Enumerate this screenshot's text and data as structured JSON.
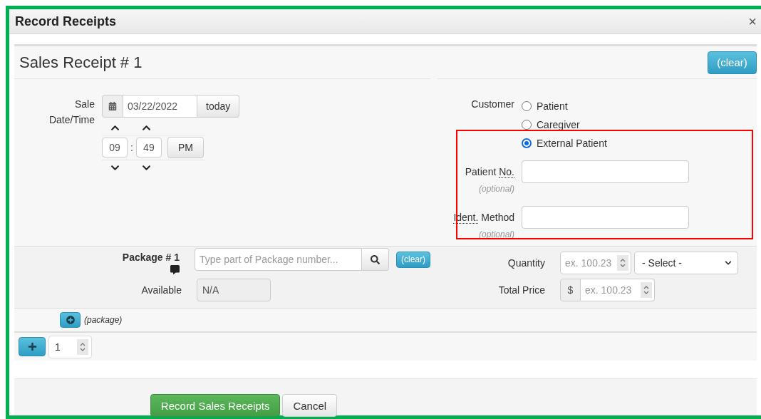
{
  "window": {
    "title": "Record Receipts",
    "close": "×"
  },
  "receipt": {
    "title": "Sales Receipt # 1",
    "clear_button": "(clear)"
  },
  "sale_datetime": {
    "label": "Sale Date/Time",
    "date": "03/22/2022",
    "today_button": "today",
    "hour": "09",
    "separator": ":",
    "minute": "49",
    "period": "PM"
  },
  "customer": {
    "label": "Customer",
    "options": [
      {
        "label": "Patient",
        "selected": false
      },
      {
        "label": "Caregiver",
        "selected": false
      },
      {
        "label": "External Patient",
        "selected": true
      }
    ]
  },
  "fields": [
    {
      "label_parts": [
        {
          "text": "Patient",
          "abbr": false
        },
        {
          "text": "No.",
          "abbr": true
        }
      ],
      "hint": "(optional)"
    },
    {
      "label_parts": [
        {
          "text": "Ident.",
          "abbr": true
        },
        {
          "text": "Method",
          "abbr": false
        }
      ],
      "hint": "(optional)"
    }
  ],
  "package": {
    "label": "Package # 1",
    "search": {
      "placeholder": "Type part of Package number..."
    },
    "clear_button": "(clear)",
    "available_label": "Available",
    "available_value": "N/A"
  },
  "quantity": {
    "label": "Quantity",
    "placeholder": "ex. 100.23",
    "unit_select": "- Select -"
  },
  "total_price": {
    "label": "Total Price",
    "currency": "$",
    "placeholder": "ex. 100.23"
  },
  "add_package": "(package)",
  "count": "1",
  "buttons": [
    {
      "label": "Record Sales Receipts",
      "kind": "primary"
    },
    {
      "label": "Cancel",
      "kind": "default"
    }
  ]
}
